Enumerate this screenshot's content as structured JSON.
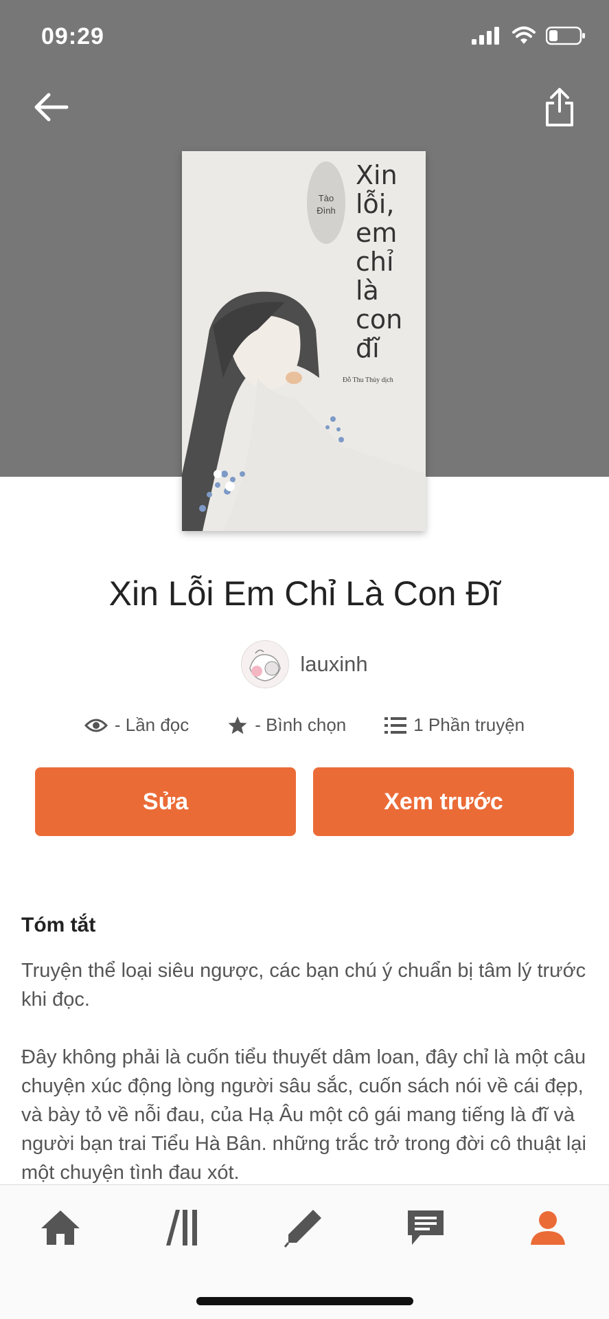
{
  "status_bar": {
    "time": "09:29"
  },
  "icons": {
    "back": "arrow-left-icon",
    "share": "share-icon",
    "views": "eye-icon",
    "votes": "star-icon",
    "parts": "list-icon"
  },
  "cover": {
    "title": "Xin lỗi, em chỉ là con đĩ",
    "author": "Tào Đình",
    "translator": "Đỗ Thu Thủy dịch"
  },
  "story": {
    "title": "Xin Lỗi Em Chỉ Là Con Đĩ",
    "author": "lauxinh"
  },
  "stats": {
    "reads": "- Lần đọc",
    "votes": "- Bình chọn",
    "parts": "1 Phần truyện"
  },
  "actions": {
    "edit": "Sửa",
    "preview": "Xem trước"
  },
  "summary": {
    "heading": "Tóm tắt",
    "paragraphs": [
      "Truyện thể loại siêu ngược, các bạn chú ý chuẩn bị tâm lý trước khi đọc.",
      "Đây không phải là cuốn tiểu thuyết dâm loan, đây chỉ là một câu chuyện xúc động lòng người sâu sắc, cuốn sách nói về cái đẹp, và bày tỏ về nỗi đau, của Hạ Âu một cô gái mang tiếng là đĩ và người bạn trai Tiểu Hà Bân. những trắc trở trong đời cô thuật lại một chuyện tình đau xót."
    ]
  },
  "tab_bar": {
    "tabs": [
      {
        "icon": "home-icon",
        "active": false
      },
      {
        "icon": "library-icon",
        "active": false
      },
      {
        "icon": "pencil-icon",
        "active": false
      },
      {
        "icon": "messages-icon",
        "active": false
      },
      {
        "icon": "profile-icon",
        "active": true
      }
    ]
  },
  "colors": {
    "accent": "#eb6b37",
    "hero_background": "#777777",
    "tab_inactive": "#555555"
  }
}
